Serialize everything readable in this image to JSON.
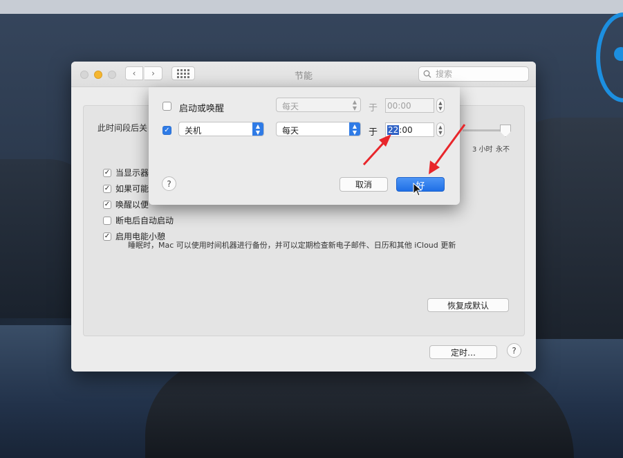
{
  "window": {
    "title": "节能",
    "search_placeholder": "搜索"
  },
  "panel": {
    "sleep_label": "此时间段后关",
    "slider_ticks": [
      "3 小时",
      "永不"
    ],
    "options": [
      {
        "label": "当显示器",
        "checked": true
      },
      {
        "label": "如果可能",
        "checked": true
      },
      {
        "label": "唤醒以便",
        "checked": true
      },
      {
        "label": "断电后自动启动",
        "checked": false
      },
      {
        "label": "启用电能小憩",
        "checked": true
      }
    ],
    "power_nap_desc": "睡眠时，Mac 可以使用时间机器进行备份，并可以定期检查新电子邮件、日历和其他 iCloud 更新",
    "restore_defaults": "恢复成默认",
    "schedule_button": "定时…",
    "help": "?"
  },
  "sheet": {
    "row1": {
      "checked": false,
      "label": "启动或唤醒",
      "frequency": "每天",
      "at": "于",
      "time": "00:00"
    },
    "row2": {
      "checked": true,
      "action": "关机",
      "frequency": "每天",
      "at": "于",
      "time_hour": "22",
      "time_rest": ":00"
    },
    "help": "?",
    "cancel": "取消",
    "ok": "好"
  },
  "colors": {
    "accent": "#2f7be6",
    "annotation_arrow": "#e8262b",
    "min_button": "#f5b630"
  }
}
